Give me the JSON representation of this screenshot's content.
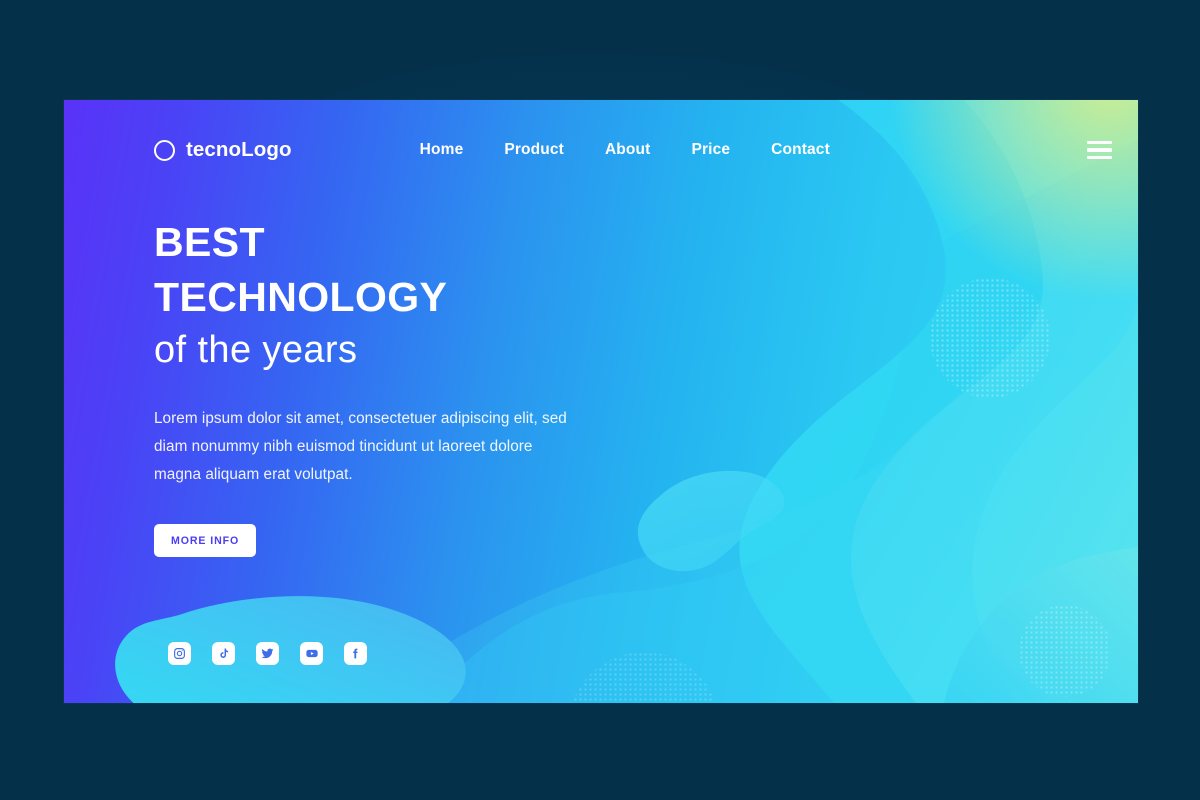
{
  "page": {
    "background_color": "#04304a",
    "panel_gradient_from": "#5a32f8",
    "panel_gradient_to": "#35d6f2",
    "accent_corner_color": "#d6ee8a"
  },
  "navbar": {
    "logo": {
      "icon": "circle-outline-icon",
      "text": "tecnoLogo"
    },
    "links": [
      {
        "label": "Home"
      },
      {
        "label": "Product"
      },
      {
        "label": "About"
      },
      {
        "label": "Price"
      },
      {
        "label": "Contact"
      }
    ],
    "menu_icon": "hamburger-menu-icon"
  },
  "hero": {
    "heading_line1": "BEST",
    "heading_line2": "TECHNOLOGY",
    "heading_line3": "of the years",
    "paragraph": "Lorem ipsum dolor sit amet, consectetuer adipiscing elit, sed diam nonummy nibh euismod tincidunt ut laoreet dolore magna aliquam erat volutpat.",
    "cta_label": "MORE INFO",
    "cta_text_color": "#4b3df2"
  },
  "social": [
    {
      "name": "instagram",
      "icon": "instagram-icon"
    },
    {
      "name": "tiktok",
      "icon": "tiktok-icon"
    },
    {
      "name": "twitter",
      "icon": "twitter-icon"
    },
    {
      "name": "youtube",
      "icon": "youtube-icon"
    },
    {
      "name": "facebook",
      "icon": "facebook-icon"
    }
  ],
  "decor": {
    "halftone_circles": 4,
    "fluid_shapes": "cyan-wave-layers",
    "pill_blob": "kidney-blob"
  }
}
